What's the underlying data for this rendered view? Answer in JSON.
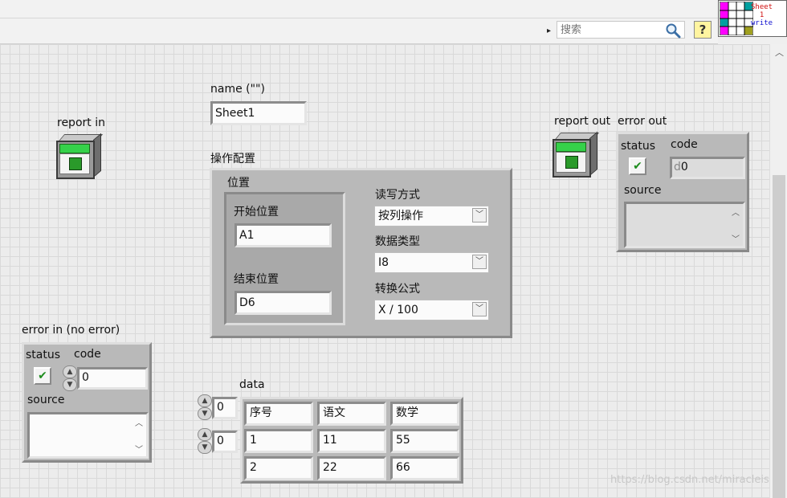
{
  "toolbar": {
    "search_placeholder": "搜索",
    "help_label": "?"
  },
  "vi_icon": {
    "lines": [
      "Sheet",
      "1",
      "write"
    ]
  },
  "name_control": {
    "label": "name (\"\")",
    "value": "Sheet1"
  },
  "report_in": {
    "label": "report in"
  },
  "report_out": {
    "label": "report out"
  },
  "config": {
    "label": "操作配置",
    "position": {
      "label": "位置",
      "start_label": "开始位置",
      "start_value": "A1",
      "end_label": "结束位置",
      "end_value": "D6"
    },
    "rw_mode": {
      "label": "读写方式",
      "value": "按列操作"
    },
    "data_type": {
      "label": "数据类型",
      "value": "I8"
    },
    "formula": {
      "label": "转换公式",
      "value": "X / 100"
    }
  },
  "error_in": {
    "label": "error in (no error)",
    "status_label": "status",
    "code_label": "code",
    "code_value": "0",
    "source_label": "source",
    "status_mark": "✔"
  },
  "error_out": {
    "label": "error out",
    "status_label": "status",
    "code_label": "code",
    "code_value": "0",
    "code_prefix": "d",
    "source_label": "source",
    "status_mark": "✔"
  },
  "data": {
    "label": "data",
    "row_index": "0",
    "col_index": "0",
    "rows": [
      [
        "序号",
        "语文",
        "数学"
      ],
      [
        "1",
        "11",
        "55"
      ],
      [
        "2",
        "22",
        "66"
      ]
    ]
  },
  "watermark": "https://blog.csdn.net/miracleis"
}
